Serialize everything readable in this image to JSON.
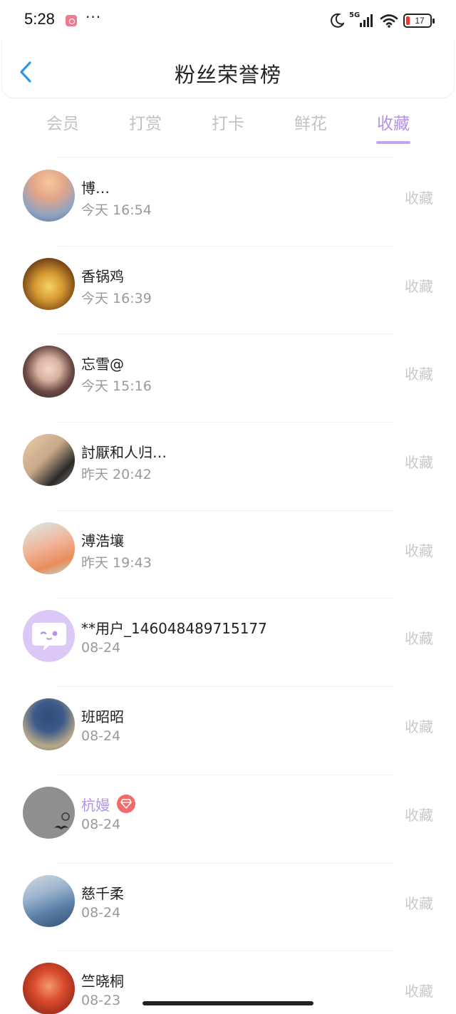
{
  "status_bar": {
    "time": "5:28",
    "dots": "···",
    "network": "5G",
    "battery": "17"
  },
  "header": {
    "title": "粉丝荣誉榜"
  },
  "tabs": [
    {
      "label": "会员",
      "active": false
    },
    {
      "label": "打赏",
      "active": false
    },
    {
      "label": "打卡",
      "active": false
    },
    {
      "label": "鲜花",
      "active": false
    },
    {
      "label": "收藏",
      "active": true
    }
  ],
  "list": [
    {
      "name": "博…",
      "time": "今天 16:54",
      "action": "收藏"
    },
    {
      "name": "香锅鸡",
      "time": "今天 16:39",
      "action": "收藏"
    },
    {
      "name": "忘雪@",
      "time": "今天 15:16",
      "action": "收藏"
    },
    {
      "name": "討厭和人归…",
      "time": "昨天 20:42",
      "action": "收藏"
    },
    {
      "name": "溥浩壤",
      "time": "昨天 19:43",
      "action": "收藏"
    },
    {
      "name": "**用户_146048489715177",
      "time": "08-24",
      "action": "收藏"
    },
    {
      "name": "班昭昭",
      "time": "08-24",
      "action": "收藏"
    },
    {
      "name": "杭嫚",
      "time": "08-24",
      "action": "收藏",
      "vip": true
    },
    {
      "name": "慈千柔",
      "time": "08-24",
      "action": "收藏"
    },
    {
      "name": "竺晓桐",
      "time": "08-23",
      "action": "收藏"
    }
  ],
  "colors": {
    "accent": "#b592e6",
    "inactive_tab": "#c2c2c2",
    "secondary_text": "#9a9a9a"
  }
}
